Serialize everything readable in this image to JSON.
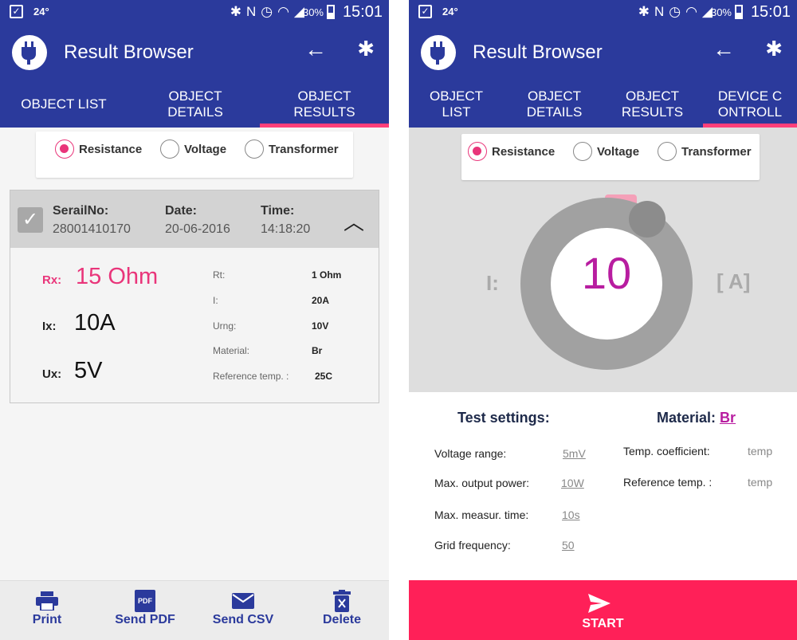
{
  "status": {
    "check": "✓",
    "temp": "24°",
    "battery": "30%",
    "time": "15:01"
  },
  "appbar": {
    "title": "Result Browser",
    "back_icon": "←",
    "bt_icon": "✱"
  },
  "left": {
    "tabs": [
      "OBJECT LIST",
      "OBJECT DETAILS",
      "OBJECT RESULTS"
    ],
    "radios": [
      "Resistance",
      "Voltage",
      "Transformer"
    ],
    "card": {
      "serial_label": "SerailNo:",
      "serial_value": "28001410170",
      "date_label": "Date:",
      "date_value": "20-06-2016",
      "time_label": "Time:",
      "time_value": "14:18:20",
      "rx_label": "Rx:",
      "rx_value": "15 Ohm",
      "ix_label": "Ix:",
      "ix_value": "10A",
      "ux_label": "Ux:",
      "ux_value": "5V",
      "rt_label": "Rt:",
      "rt_value": "1 Ohm",
      "i_label": "I:",
      "i_value": "20A",
      "urng_label": "Urng:",
      "urng_value": "10V",
      "mat_label": "Material:",
      "mat_value": "Br",
      "ref_label": "Reference temp. :",
      "ref_value": "25C"
    },
    "actions": [
      "Print",
      "Send PDF",
      "Send CSV",
      "Delete"
    ],
    "pdf_badge": "PDF"
  },
  "right": {
    "tabs": [
      "OBJECT LIST",
      "OBJECT DETAILS",
      "OBJECT RESULTS",
      "DEVICE C ONTROLL"
    ],
    "radios": [
      "Resistance",
      "Voltage",
      "Transformer"
    ],
    "gauge": {
      "value": "10",
      "left_label": "I:",
      "right_label": "[ A]"
    },
    "test_settings_title": "Test settings:",
    "material_title": "Material:",
    "material_value": "Br",
    "settings": [
      {
        "label": "Voltage range:",
        "value": "5mV"
      },
      {
        "label": "Max. output power:",
        "value": "10W"
      },
      {
        "label": "Max. measur. time:",
        "value": "10s"
      },
      {
        "label": "Grid frequency:",
        "value": "50"
      }
    ],
    "material_settings": [
      {
        "label": "Temp. coefficient:",
        "value": "temp"
      },
      {
        "label": "Reference temp. :",
        "value": "temp"
      }
    ],
    "start_label": "START"
  },
  "colors": {
    "primary": "#2b3a9c",
    "accent": "#ff3f7a",
    "start": "#ff2058",
    "value": "#b81da0",
    "rx": "#e9357a"
  }
}
